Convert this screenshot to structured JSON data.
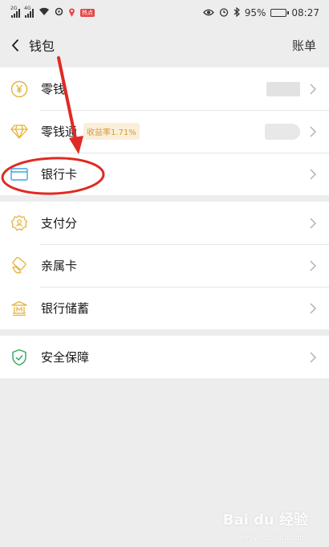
{
  "status_bar": {
    "signal_1": "2G",
    "signal_2": "4G",
    "notice_badge": "热点",
    "battery_percent": "95%",
    "battery_level": 0.95,
    "time": "08:27"
  },
  "nav": {
    "title": "钱包",
    "right_label": "账单"
  },
  "groups": [
    {
      "items": [
        {
          "label": "零钱",
          "icon": "yuan-icon",
          "value_hidden": true
        },
        {
          "label": "零钱通",
          "icon": "diamond-icon",
          "tag": "收益率1.71%",
          "value_hidden": true
        },
        {
          "label": "银行卡",
          "icon": "bank-card-icon"
        }
      ]
    },
    {
      "items": [
        {
          "label": "支付分",
          "icon": "score-icon"
        },
        {
          "label": "亲属卡",
          "icon": "family-card-icon"
        },
        {
          "label": "银行储蓄",
          "icon": "bank-savings-icon"
        }
      ]
    },
    {
      "items": [
        {
          "label": "安全保障",
          "icon": "shield-icon"
        }
      ]
    }
  ],
  "colors": {
    "accent_gold": "#e4b33b",
    "accent_green": "#2fa65d",
    "annotation_red": "#e02a23",
    "background": "#ededed"
  },
  "watermark": {
    "text": "Bai du 经验",
    "sub": "jingyan.baidu.com"
  }
}
